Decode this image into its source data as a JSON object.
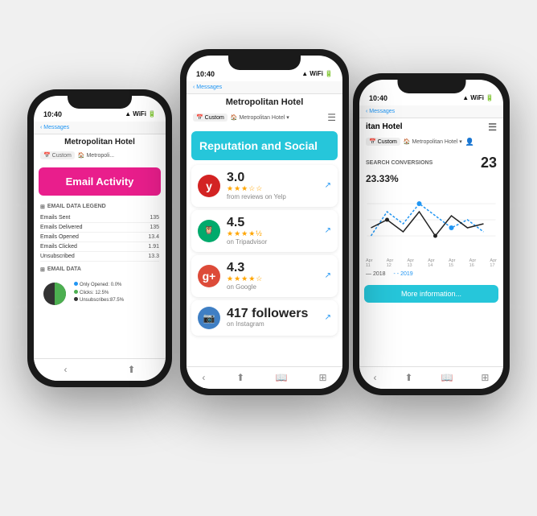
{
  "phones": {
    "left": {
      "time": "10:40",
      "title": "Metropolitan Hotel",
      "nav": {
        "custom": "Custom",
        "hotel": "Metropoli..."
      },
      "email_header": "Email Activity",
      "legend_label": "EMAIL DATA LEGEND",
      "legend_items": [
        {
          "label": "Emails Sent",
          "value": "135"
        },
        {
          "label": "Emails Delivered",
          "value": "135"
        },
        {
          "label": "Emails Opened",
          "value": "13.4"
        },
        {
          "label": "Emails Clicked",
          "value": "1.91"
        },
        {
          "label": "Unsubscribed",
          "value": "13.3"
        }
      ],
      "data_label": "EMAIL DATA",
      "pie_legend": [
        {
          "color": "#2196f3",
          "label": "Only Opened: 0.0%"
        },
        {
          "color": "#4caf50",
          "label": "Clicks: 12.5%"
        },
        {
          "color": "#333",
          "label": "Unsubscribes:87.5%"
        }
      ]
    },
    "center": {
      "time": "10:40",
      "title": "Metropolitan Hotel",
      "nav": {
        "custom": "Custom",
        "hotel": "Metropolitan Hotel"
      },
      "rep_header": "Reputation and Social",
      "reviews": [
        {
          "icon": "yelp",
          "score": "3.0",
          "stars": 3,
          "source": "from reviews on Yelp"
        },
        {
          "icon": "tripadvisor",
          "score": "4.5",
          "stars": 4.5,
          "source": "on Tripadvisor"
        },
        {
          "icon": "google",
          "score": "4.3",
          "stars": 4,
          "source": "on Google"
        },
        {
          "icon": "instagram",
          "score": "417 followers",
          "stars": 0,
          "source": "on Instagram"
        }
      ]
    },
    "right": {
      "time": "10:40",
      "title": "itan Hotel",
      "nav": {
        "custom": "Custom",
        "hotel": "Metropolitan Hotel"
      },
      "search_label": "SEARCH CONVERSIONS",
      "search_count": "23",
      "search_pct": "23.33%",
      "chart_labels": [
        "Apr 11",
        "Apr 12",
        "Apr 13",
        "Apr 14",
        "Apr 15",
        "Apr 16",
        "Apr 17"
      ],
      "legend_2018": "2018",
      "legend_2019": "2019",
      "more_info": "More information..."
    }
  }
}
